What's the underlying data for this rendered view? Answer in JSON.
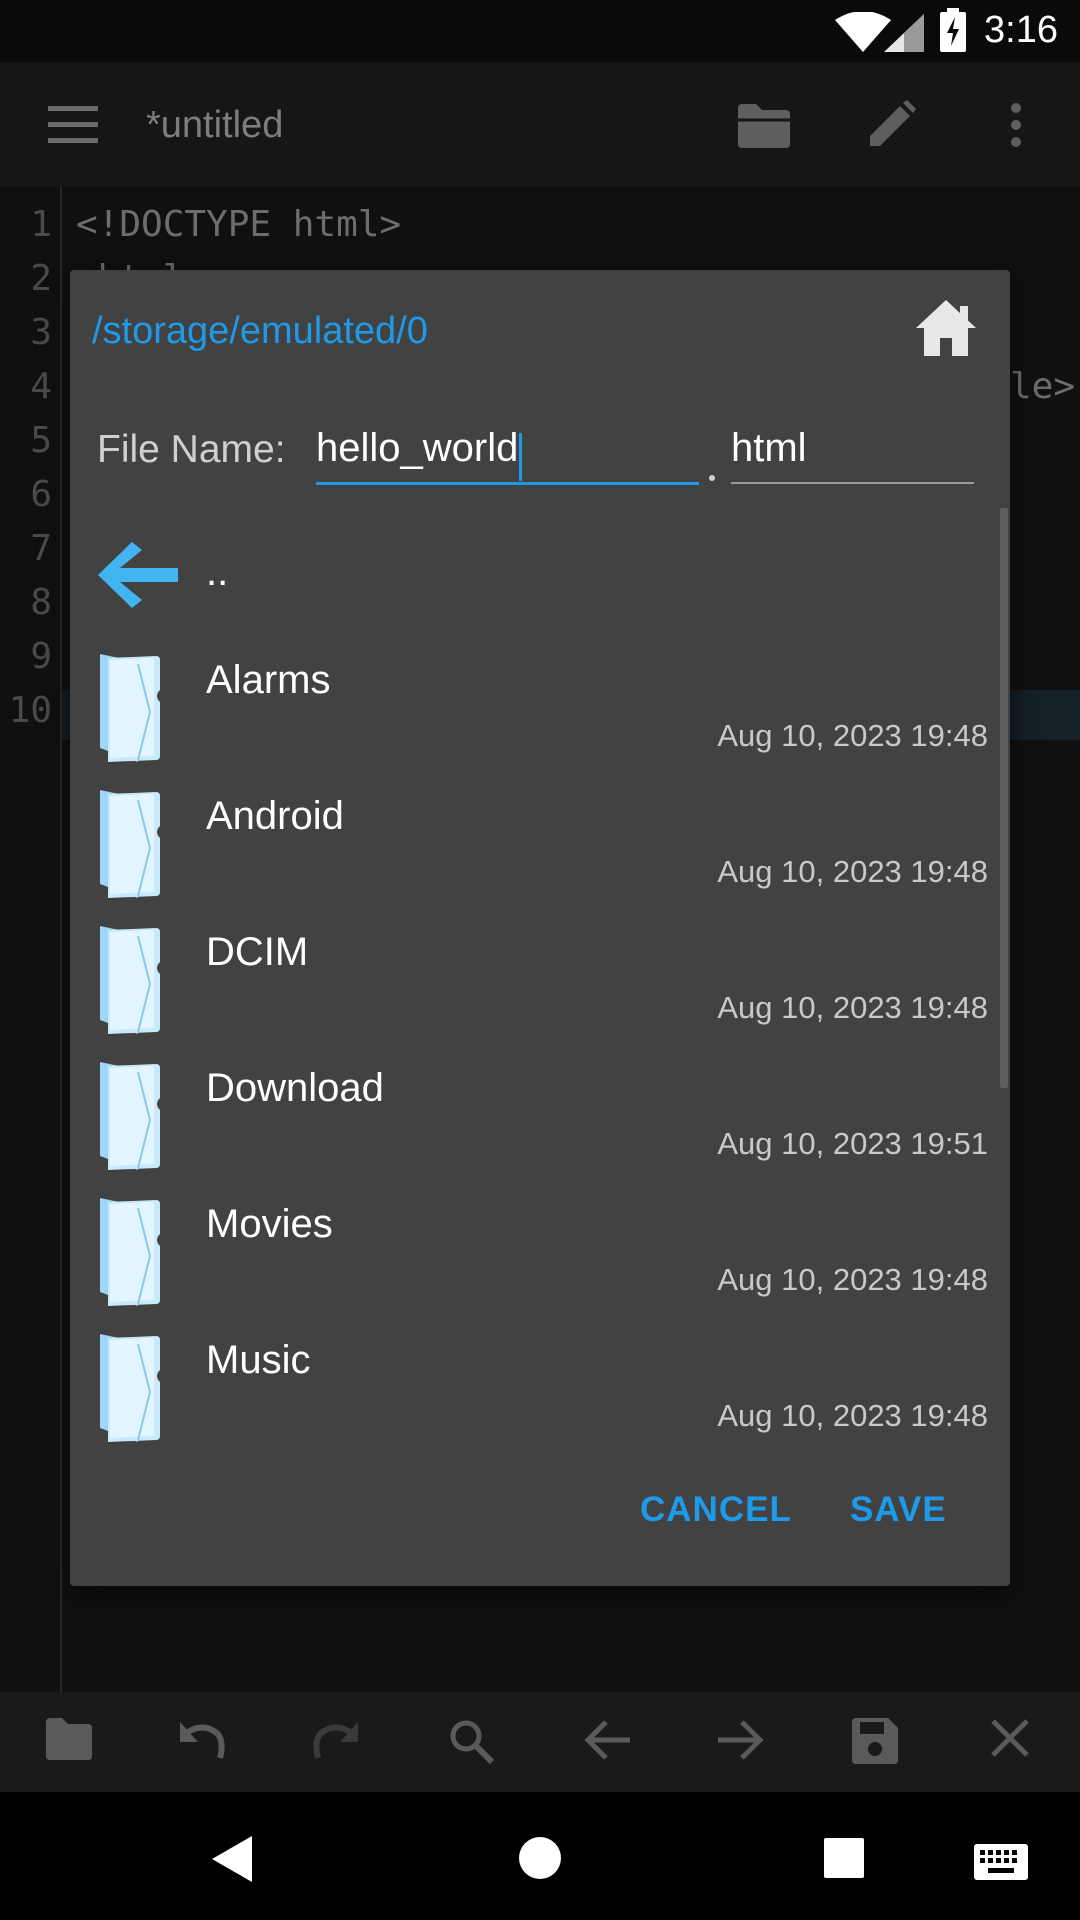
{
  "status_bar": {
    "time": "3:16",
    "icons": [
      "wifi-icon",
      "signal-icon",
      "battery-charging-icon"
    ]
  },
  "app_bar": {
    "title": "*untitled",
    "icons": [
      "menu-icon",
      "folder-open-icon",
      "pencil-icon",
      "more-vert-icon"
    ]
  },
  "editor": {
    "line_numbers": [
      "1",
      "2",
      "3",
      "4",
      "5",
      "6",
      "7",
      "8",
      "9",
      "10"
    ],
    "visible_code": {
      "line1": "<!DOCTYPE html>",
      "line2": "<html>",
      "line4": "le>"
    }
  },
  "dialog": {
    "path": "/storage/emulated/0",
    "file_name_label": "File Name:",
    "file_name_value": "hello_world",
    "extension_value": "html",
    "parent_label": "..",
    "items": [
      {
        "name": "Alarms",
        "date": "Aug 10, 2023 19:48"
      },
      {
        "name": "Android",
        "date": "Aug 10, 2023 19:48"
      },
      {
        "name": "DCIM",
        "date": "Aug 10, 2023 19:48"
      },
      {
        "name": "Download",
        "date": "Aug 10, 2023 19:51"
      },
      {
        "name": "Movies",
        "date": "Aug 10, 2023 19:48"
      },
      {
        "name": "Music",
        "date": "Aug 10, 2023 19:48"
      }
    ],
    "cancel_label": "CANCEL",
    "save_label": "SAVE",
    "accent_color": "#1e9ae8"
  },
  "bottom_bar": {
    "icons": [
      "folder-icon",
      "undo-icon",
      "redo-icon",
      "search-icon",
      "arrow-left-icon",
      "arrow-right-icon",
      "save-icon",
      "close-icon"
    ]
  },
  "nav_bar": {
    "icons": [
      "back-icon",
      "home-icon",
      "recents-icon",
      "keyboard-icon"
    ]
  }
}
